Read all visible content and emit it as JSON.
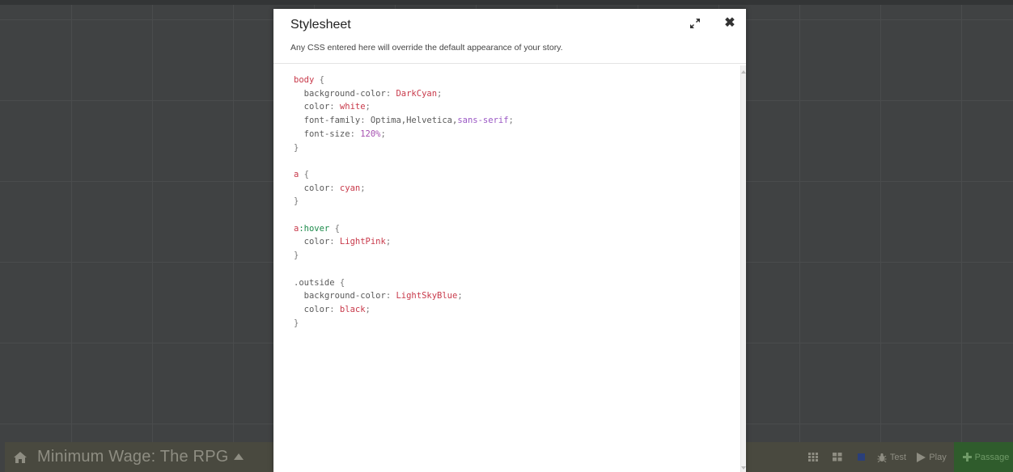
{
  "story": {
    "title": "Minimum Wage: The RPG"
  },
  "toolbar": {
    "test_label": "Test",
    "play_label": "Play",
    "passage_label": "Passage",
    "icons": [
      "home-icon",
      "caret-up-icon",
      "grid-small-icon",
      "grid-medium-icon",
      "grid-large-icon",
      "bug-icon",
      "play-icon",
      "plus-icon"
    ]
  },
  "modal": {
    "title": "Stylesheet",
    "description": "Any CSS entered here will override the default appearance of your story.",
    "icons": [
      "maximize-icon",
      "close-icon"
    ]
  },
  "colors": {
    "passage_button_bg": "#2f5c2c",
    "toolbar_bg": "#49493f",
    "css_keyword": "#c8394a",
    "css_variable": "#9a57c4",
    "css_pseudo": "#1b8a4a"
  },
  "stylesheet": {
    "rules": [
      {
        "selector": "body",
        "declarations": [
          {
            "prop": "background-color",
            "value": "DarkCyan"
          },
          {
            "prop": "color",
            "value": "white"
          },
          {
            "prop": "font-family",
            "value": "Optima,Helvetica,sans-serif"
          },
          {
            "prop": "font-size",
            "value": "120%"
          }
        ]
      },
      {
        "selector": "a",
        "declarations": [
          {
            "prop": "color",
            "value": "cyan"
          }
        ]
      },
      {
        "selector": "a:hover",
        "declarations": [
          {
            "prop": "color",
            "value": "LightPink"
          }
        ]
      },
      {
        "selector": ".outside",
        "declarations": [
          {
            "prop": "background-color",
            "value": "LightSkyBlue"
          },
          {
            "prop": "color",
            "value": "black"
          }
        ]
      }
    ]
  }
}
